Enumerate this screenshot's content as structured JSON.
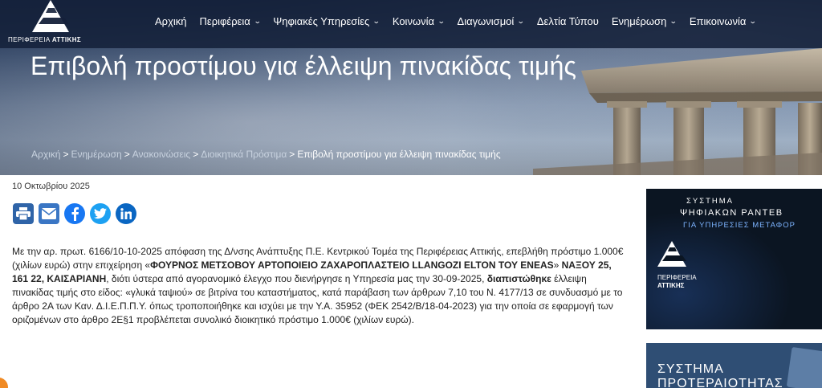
{
  "logo": {
    "text_normal": "ΠΕΡΙΦΕΡΕΙΑ ",
    "text_bold": "ΑΤΤΙΚΗΣ"
  },
  "nav": {
    "items": [
      {
        "label": "Αρχική",
        "dropdown": false
      },
      {
        "label": "Περιφέρεια",
        "dropdown": true
      },
      {
        "label": "Ψηφιακές Υπηρεσίες",
        "dropdown": true
      },
      {
        "label": "Κοινωνία",
        "dropdown": true
      },
      {
        "label": "Διαγωνισμοί",
        "dropdown": true
      },
      {
        "label": "Δελτία Τύπου",
        "dropdown": false
      },
      {
        "label": "Ενημέρωση",
        "dropdown": true
      },
      {
        "label": "Επικοινωνία",
        "dropdown": true
      }
    ],
    "chevron": "⌄"
  },
  "page": {
    "title": "Επιβολή προστίμου για έλλειψη πινακίδας τιμής",
    "breadcrumb": [
      "Αρχική",
      "Ενημέρωση",
      "Ανακοινώσεις",
      "Διοικητικά Πρόστιμα"
    ],
    "breadcrumb_current": "Επιβολή προστίμου για έλλειψη πινακίδας τιμής",
    "breadcrumb_sep": ">",
    "date": "10 Οκτωβρίου 2025"
  },
  "share": {
    "buttons": [
      "print",
      "email",
      "facebook",
      "twitter",
      "linkedin"
    ],
    "colors": {
      "print": "#2f64a8",
      "email": "#3a76c4",
      "facebook": "#1877f2",
      "twitter": "#1da1f2",
      "linkedin": "#0a66c2"
    }
  },
  "article": {
    "p1": "Με την αρ. πρωτ. 6166/10-10-2025 απόφαση της Δ/νσης Ανάπτυξης Π.Ε. Κεντρικού Τομέα της Περιφέρειας Αττικής, επεβλήθη πρόστιμο 1.000€ (χιλίων ευρώ) στην επιχείρηση «",
    "b1": "ΦΟΥΡΝΟΣ ΜΕΤΣΟΒΟΥ ΑΡΤΟΠΟΙΕΙΟ ΖΑΧΑΡΟΠΛΑΣΤΕΙΟ LLANGOZI ELTON ΤΟΥ ENEAS",
    "p2": "» ",
    "b2": "ΝΑΞΟΥ 25, 161 22, ΚΑΙΣΑΡΙΑΝΗ",
    "p3": ", διότι ύστερα από αγορανομικό έλεγχο που διενήργησε η Υπηρεσία μας την 30-09-2025, ",
    "b3": "διαπιστώθηκε",
    "p4": " έλλειψη πινακίδας τιμής στο είδος: «γλυκά ταψιού» σε βιτρίνα του καταστήματος, κατά  παράβαση των άρθρων 7,10 του Ν. 4177/13 σε συνδυασμό με το άρθρο 2Α των Καν. Δ.Ι.Ε.Π.Π.Υ. όπως τροποποιήθηκε και ισχύει με την Υ.Α. 35952 (ΦΕΚ 2542/Β/18-04-2023) για την οποία σε εφαρμογή των οριζομένων στο άρθρο 2Ε§1 προβλέπεται συνολικό διοικητικό πρόστιμο 1.000€ (χιλίων ευρώ)."
  },
  "sidebar": {
    "banner1": {
      "line1": "ΣΥΣΤΗΜΑ",
      "line2": "ΨΗΦΙΑΚΩΝ ΡΑΝΤΕΒ",
      "line3": "ΓΙΑ ΥΠΗΡΕΣΙΕΣ ΜΕΤΑΦΟΡ",
      "logo_line1": "ΠΕΡΙΦΕΡΕΙΑ",
      "logo_line2": "ΑΤΤΙΚΗΣ"
    },
    "banner2": {
      "line1": "ΣΥΣΤΗΜΑ",
      "line2": "ΠΡΟΤΕΡΑΙΟΤΗΤΑΣ"
    }
  },
  "colors": {
    "nav_bg": "#15213a",
    "title": "#ffffff",
    "banner1_bg": "#0b1522",
    "banner1_accent": "#7db4ff",
    "banner2_bg": "#2f4e74"
  }
}
